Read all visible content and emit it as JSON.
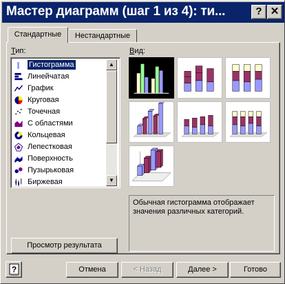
{
  "window": {
    "title": "Мастер диаграмм (шаг 1 из 4): ти...",
    "help_glyph": "?",
    "close_glyph": "✕"
  },
  "tabs": [
    {
      "label": "Стандартные",
      "active": true
    },
    {
      "label": "Нестандартные",
      "active": false
    }
  ],
  "type_label": {
    "hotkey": "Т",
    "rest": "ип:"
  },
  "view_label": {
    "hotkey": "В",
    "rest": "ид:"
  },
  "chart_types": [
    {
      "label": "Гистограмма",
      "icon": "column-chart-icon",
      "selected": true
    },
    {
      "label": "Линейчатая",
      "icon": "bar-chart-icon",
      "selected": false
    },
    {
      "label": "График",
      "icon": "line-chart-icon",
      "selected": false
    },
    {
      "label": "Круговая",
      "icon": "pie-chart-icon",
      "selected": false
    },
    {
      "label": "Точечная",
      "icon": "scatter-chart-icon",
      "selected": false
    },
    {
      "label": "С областями",
      "icon": "area-chart-icon",
      "selected": false
    },
    {
      "label": "Кольцевая",
      "icon": "donut-chart-icon",
      "selected": false
    },
    {
      "label": "Лепестковая",
      "icon": "radar-chart-icon",
      "selected": false
    },
    {
      "label": "Поверхность",
      "icon": "surface-chart-icon",
      "selected": false
    },
    {
      "label": "Пузырьковая",
      "icon": "bubble-chart-icon",
      "selected": false
    },
    {
      "label": "Биржевая",
      "icon": "stock-chart-icon",
      "selected": false
    }
  ],
  "subtypes": [
    {
      "name": "clustered-column",
      "selected": true
    },
    {
      "name": "stacked-column",
      "selected": false
    },
    {
      "name": "100-percent-stacked-column",
      "selected": false
    },
    {
      "name": "3d-clustered-column",
      "selected": false
    },
    {
      "name": "3d-stacked-column",
      "selected": false
    },
    {
      "name": "3d-100-percent-stacked-column",
      "selected": false
    },
    {
      "name": "3d-column",
      "selected": false
    }
  ],
  "description": "Обычная гистограмма отображает значения различных категорий.",
  "buttons": {
    "preview": "Просмотр результата",
    "cancel": "Отмена",
    "back": "< Назад",
    "next": "Далее >",
    "finish": "Готово"
  },
  "colors": {
    "titlebar": "#0a246a",
    "face": "#d4d0c8",
    "series_purple": "#993366",
    "series_lavender": "#9999ff",
    "series_cream": "#ffffcc"
  }
}
